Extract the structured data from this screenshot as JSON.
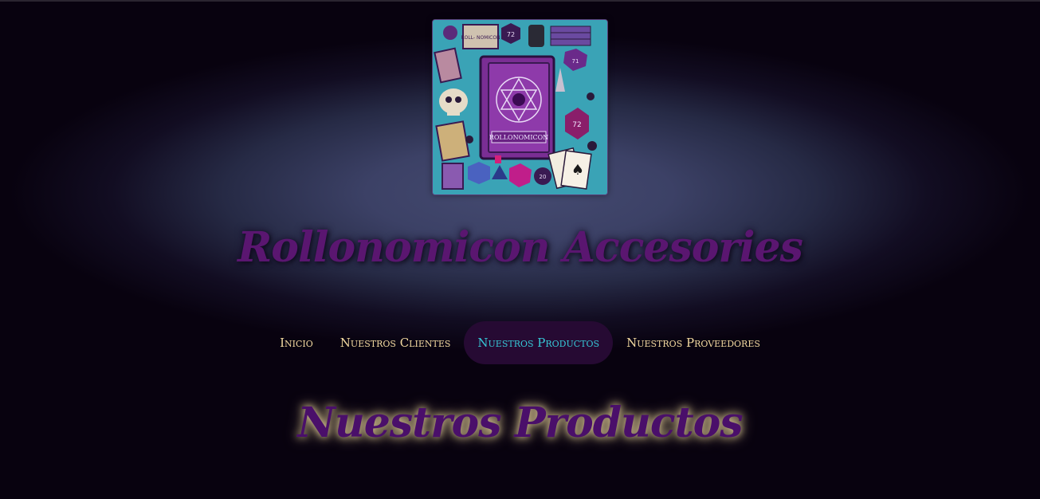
{
  "header": {
    "logo_text": "ROLLONOMICON",
    "logo_small_text": "ROLL- NOMICON",
    "logo_die_a": "72",
    "logo_die_b": "20",
    "logo_die_c": "71",
    "site_title": "Rollonomicon Accesories"
  },
  "nav": {
    "items": [
      {
        "label": "Inicio",
        "active": false
      },
      {
        "label": "Nuestros Clientes",
        "active": false
      },
      {
        "label": "Nuestros Productos",
        "active": true
      },
      {
        "label": "Nuestros Proveedores",
        "active": false
      }
    ]
  },
  "main": {
    "section_title": "Nuestros Productos"
  },
  "colors": {
    "background": "#08020f",
    "nav_text": "#f2d9a0",
    "nav_active_text": "#36c7d6",
    "nav_active_bg": "#260a33",
    "title": "#5a1670"
  }
}
